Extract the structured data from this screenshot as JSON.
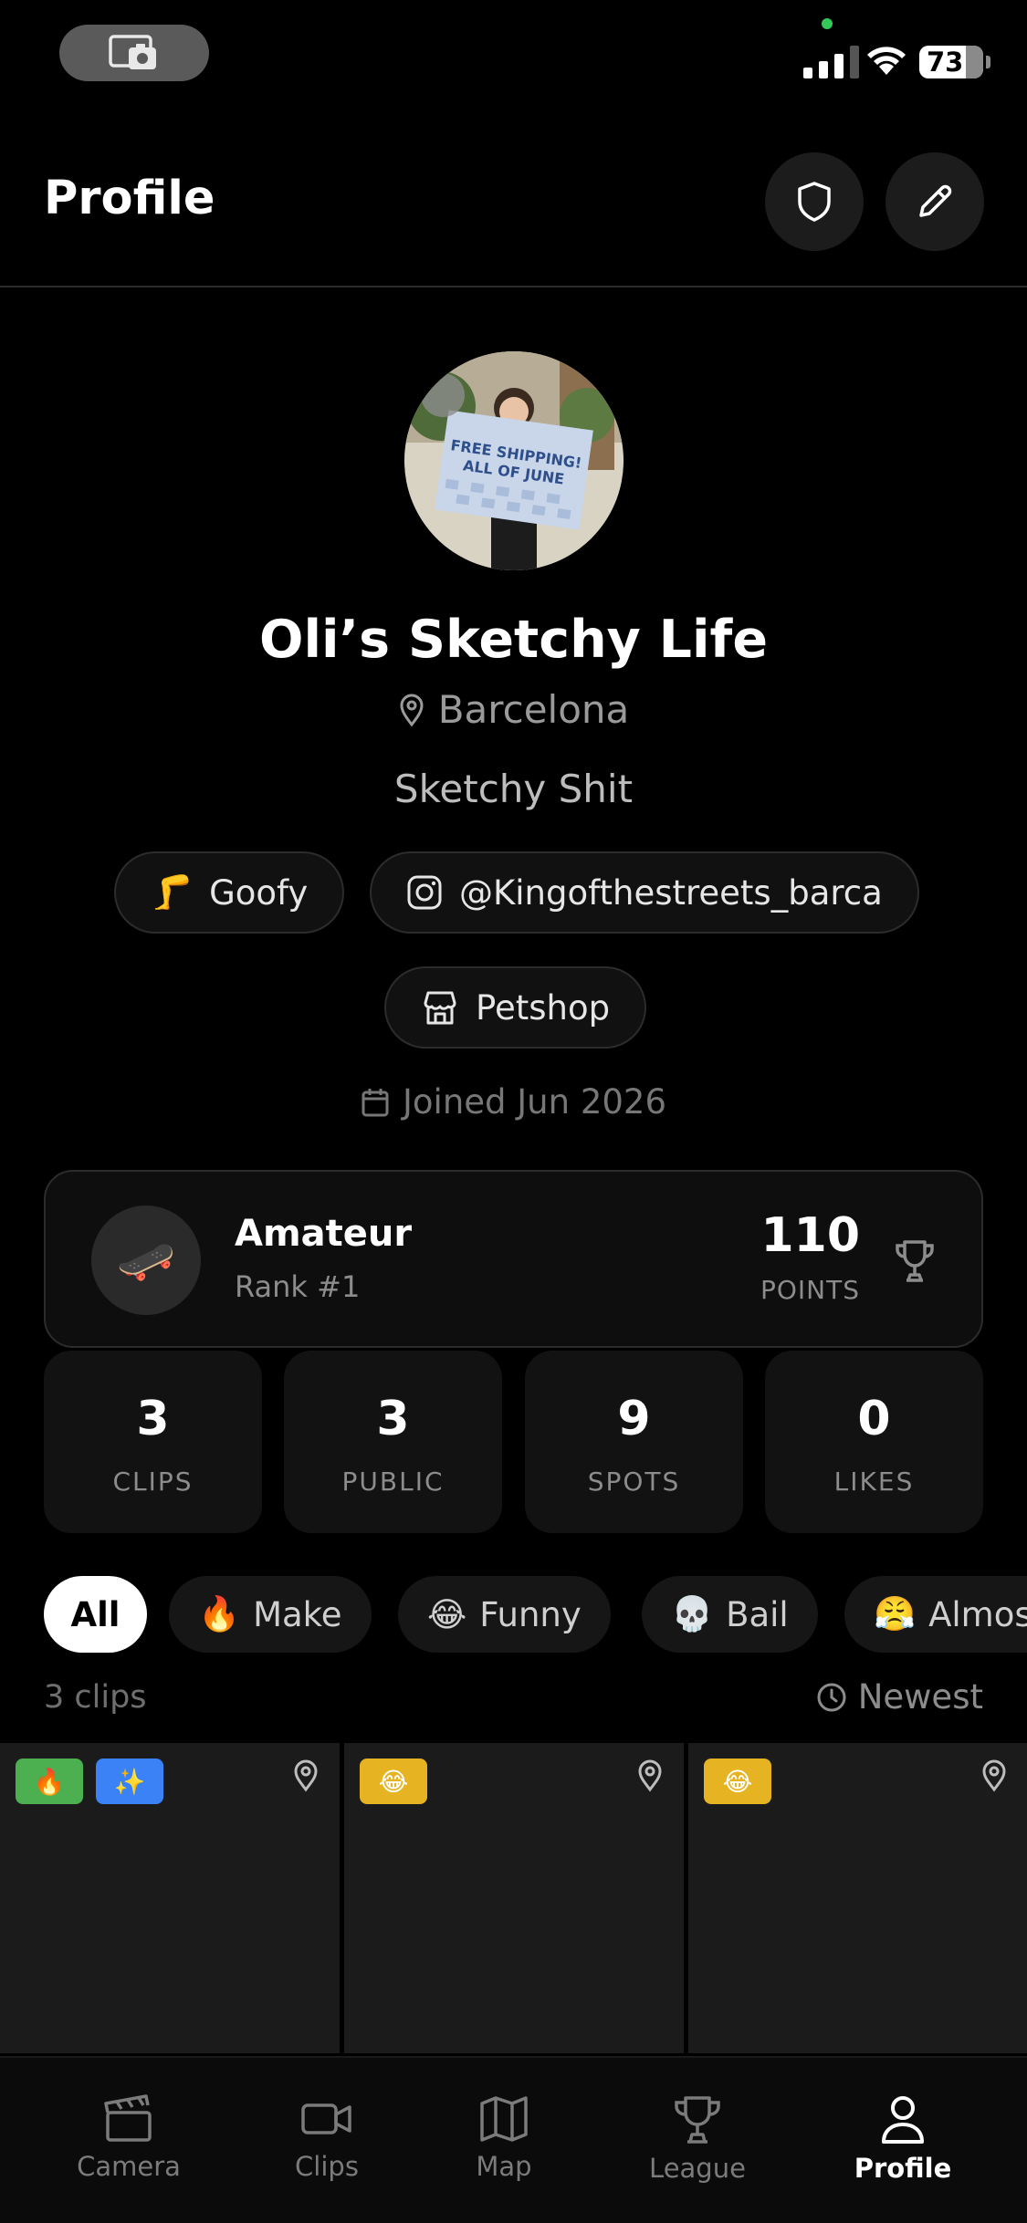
{
  "status_bar": {
    "battery": "73"
  },
  "header": {
    "title": "Profile"
  },
  "profile": {
    "avatar_sign_text": "FREE SHIPPING! ALL OF JUNE",
    "name": "Oli’s Sketchy Life",
    "location": "Barcelona",
    "bio": "Sketchy Shit",
    "stance": {
      "emoji": "🦵",
      "label": "Goofy"
    },
    "instagram": "@Kingofthestreets_barca",
    "shop": "Petshop",
    "joined": "Joined Jun 2026"
  },
  "rank": {
    "emoji": "🛹",
    "level": "Amateur",
    "rank_label": "Rank #1",
    "points": "110",
    "points_label": "POINTS"
  },
  "stats": [
    {
      "value": "3",
      "label": "CLIPS"
    },
    {
      "value": "3",
      "label": "PUBLIC"
    },
    {
      "value": "9",
      "label": "SPOTS"
    },
    {
      "value": "0",
      "label": "LIKES"
    }
  ],
  "filters": [
    {
      "emoji": "",
      "label": "All"
    },
    {
      "emoji": "🔥",
      "label": "Make"
    },
    {
      "emoji": "😂",
      "label": "Funny"
    },
    {
      "emoji": "💀",
      "label": "Bail"
    },
    {
      "emoji": "😤",
      "label": "Almos"
    }
  ],
  "clips_summary": {
    "count": "3 clips",
    "sort": "Newest"
  },
  "clips": [
    {
      "tags": [
        {
          "emoji": "🔥",
          "color": "#4caf50"
        },
        {
          "emoji": "✨",
          "color": "#3b82f6"
        }
      ]
    },
    {
      "tags": [
        {
          "emoji": "😂",
          "color": "#e6b422"
        }
      ]
    },
    {
      "tags": [
        {
          "emoji": "😂",
          "color": "#e6b422"
        }
      ]
    }
  ],
  "tab_bar": [
    {
      "icon": "clapperboard-icon",
      "label": "Camera"
    },
    {
      "icon": "video-camera-icon",
      "label": "Clips"
    },
    {
      "icon": "map-icon",
      "label": "Map"
    },
    {
      "icon": "trophy-icon",
      "label": "League"
    },
    {
      "icon": "person-icon",
      "label": "Profile"
    }
  ],
  "colors": {
    "background": "#000000",
    "card": "#121212",
    "active_filter": "#ffffff"
  }
}
